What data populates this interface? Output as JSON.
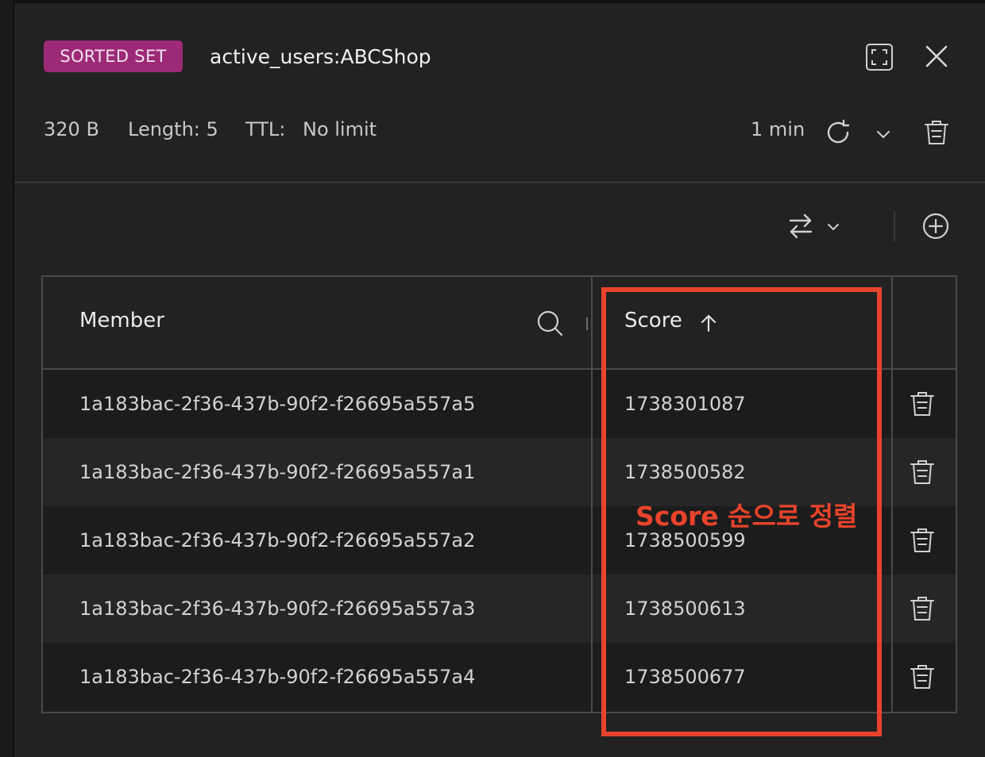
{
  "header": {
    "type_badge": "SORTED SET",
    "key_name": "active_users:ABCShop"
  },
  "meta": {
    "size": "320 B",
    "length": "Length: 5",
    "ttl_label": "TTL:",
    "ttl_value": "No limit",
    "refresh_interval": "1 min"
  },
  "table": {
    "columns": {
      "member": "Member",
      "score": "Score"
    },
    "rows": [
      {
        "member": "1a183bac-2f36-437b-90f2-f26695a557a5",
        "score": "1738301087"
      },
      {
        "member": "1a183bac-2f36-437b-90f2-f26695a557a1",
        "score": "1738500582"
      },
      {
        "member": "1a183bac-2f36-437b-90f2-f26695a557a2",
        "score": "1738500599"
      },
      {
        "member": "1a183bac-2f36-437b-90f2-f26695a557a3",
        "score": "1738500613"
      },
      {
        "member": "1a183bac-2f36-437b-90f2-f26695a557a4",
        "score": "1738500677"
      }
    ]
  },
  "annotation": {
    "text": "Score 순으로 정렬",
    "color": "#e8442b"
  },
  "colors": {
    "badge": "#9c2a77",
    "background": "#222222",
    "highlight": "#e8442b"
  }
}
